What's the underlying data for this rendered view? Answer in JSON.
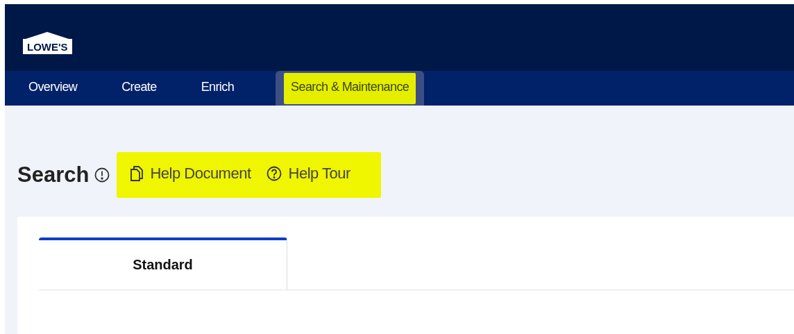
{
  "header": {
    "logo": "LOWE'S"
  },
  "nav": [
    {
      "label": "Overview",
      "selected": false,
      "highlighted": false
    },
    {
      "label": "Create",
      "selected": false,
      "highlighted": false
    },
    {
      "label": "Enrich",
      "selected": false,
      "highlighted": false
    },
    {
      "label": "Search & Maintenance",
      "selected": true,
      "highlighted": true
    }
  ],
  "page": {
    "title": "Search",
    "help_highlighted": true,
    "help_links": [
      {
        "kind": "document",
        "label": "Help Document"
      },
      {
        "kind": "tour",
        "label": "Help Tour"
      }
    ]
  },
  "tabs": [
    {
      "label": "Standard",
      "selected": true
    }
  ]
}
